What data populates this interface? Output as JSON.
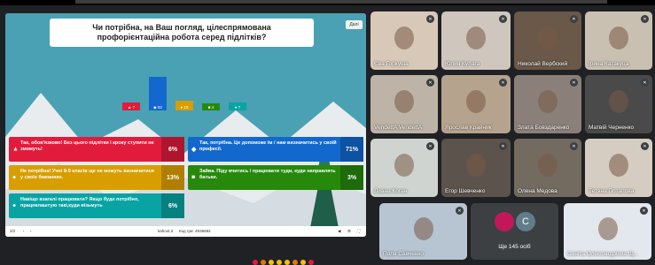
{
  "kahoot": {
    "question": "Чи потрібна, на Ваш погляд, цілеспрямована профорієнтаційна робота серед підлітків?",
    "next_label": "Далі",
    "bars": [
      {
        "shape": "▲",
        "count": "7",
        "color": "#e21b3c"
      },
      {
        "shape": "◆",
        "count": "82",
        "color": "#1368ce"
      },
      {
        "shape": "●",
        "count": "15",
        "color": "#d89e00"
      },
      {
        "shape": "■",
        "count": "4",
        "color": "#26890c"
      },
      {
        "shape": "●",
        "count": "7",
        "color": "#0aa3a3"
      }
    ],
    "answers": [
      {
        "shape": "▲",
        "text": "Так, обов'язково! Без цього підлітки і кроку ступити не зможуть!",
        "pct": "6%",
        "color": "#e21b3c"
      },
      {
        "shape": "◆",
        "text": "Так, потрібна. Це допоможе їм / нам визначитись у своїй професії.",
        "pct": "71%",
        "color": "#1368ce"
      },
      {
        "shape": "●",
        "text": "Не потрібна! Учні 8-9 класів ще не можуть визначитися у своїх бажаннях.",
        "pct": "13%",
        "color": "#d89e00"
      },
      {
        "shape": "■",
        "text": "Зайва. Піду вчитись / працювати туди, куди направлять батьки.",
        "pct": "3%",
        "color": "#26890c"
      },
      {
        "shape": "●",
        "text": "Навіщо взагалі працювати? Якщо буде потрібно, працевлаштую такі,куди візьмуть",
        "pct": "6%",
        "color": "#0aa3a3"
      }
    ],
    "footer": {
      "page": "2/2",
      "site": "kahoot.it",
      "pin": "Код гри: 4936684"
    }
  },
  "participants": [
    {
      "name": "Єва Горкуша",
      "bg": "#d8c8b8"
    },
    {
      "name": "Юлия Кулага",
      "bg": "#cfc6bd"
    },
    {
      "name": "Николай Вербский",
      "bg": "#6a5848"
    },
    {
      "name": "Ірина Катакуца",
      "bg": "#c9c0b2"
    },
    {
      "name": "VendettA VendettA",
      "bg": "#bdb4a7"
    },
    {
      "name": "Ярослав Крайник",
      "bg": "#b6a38d"
    },
    {
      "name": "Злата Бовздаренко",
      "bg": "#8b8079"
    },
    {
      "name": "Матвій Черненко",
      "bg": "#4a4a4a"
    },
    {
      "name": "Лиана Коган",
      "bg": "#cfd4d0"
    },
    {
      "name": "Егор Шевченко",
      "bg": "#5c534d"
    },
    {
      "name": "Олена Медова",
      "bg": "#736b60"
    },
    {
      "name": "Тетяна Потапова",
      "bg": "#d6cdc2"
    },
    {
      "name": "Поля Савченко",
      "bg": "#b7c4d1"
    },
    {
      "name": "Саніта Олександрівна Щ...",
      "bg": "#e3e8ee"
    }
  ],
  "more": {
    "label": "Ще 145 осіб",
    "avatar_letter": "С"
  }
}
